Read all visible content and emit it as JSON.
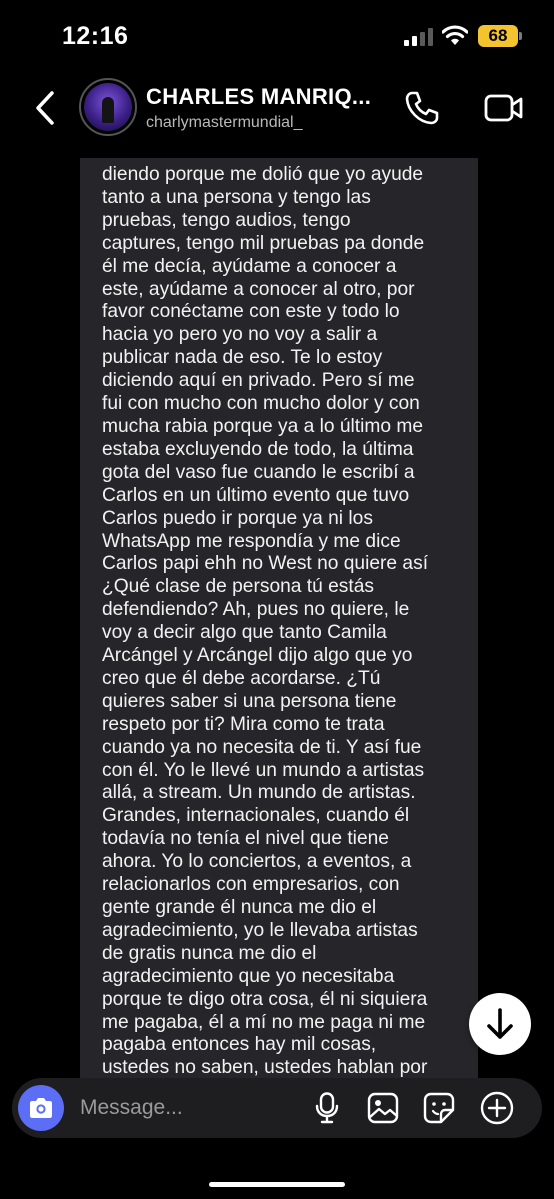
{
  "status_bar": {
    "time": "12:16",
    "battery": "68"
  },
  "header": {
    "name": "CHARLES MANRIQ...",
    "username": "charlymastermundial_"
  },
  "message": {
    "text": "diendo porque me dolió que yo ayude\ntanto a una persona y tengo las\npruebas, tengo audios, tengo\ncaptures, tengo mil pruebas pa donde\nél me decía, ayúdame a conocer a\neste, ayúdame a conocer al otro, por\nfavor conéctame con este y todo lo\nhacia yo pero yo no voy a salir a\npublicar nada de eso. Te lo estoy\ndiciendo aquí en privado. Pero sí me\nfui con mucho con mucho dolor y con\nmucha rabia porque ya a lo último me\nestaba excluyendo de todo, la última\ngota del vaso fue cuando le escribí a\nCarlos en un último evento que tuvo\nCarlos puedo ir porque ya ni los\nWhatsApp me respondía y me dice\nCarlos papi ehh no West no quiere así\n¿Qué clase de persona tú estás\ndefendiendo? Ah, pues no quiere, le\nvoy a decir algo que tanto Camila\nArcángel y Arcángel dijo algo que yo\ncreo que él debe acordarse. ¿Tú\nquieres saber si una persona tiene\nrespeto por ti? Mira como te trata\ncuando ya no necesita de ti. Y así fue\ncon él. Yo le llevé un mundo a artistas\nallá, a stream. Un mundo de artistas.\nGrandes, internacionales, cuando él\ntodavía no tenía el nivel que tiene\nahora. Yo lo conciertos, a eventos, a\nrelacionarlos con empresarios, con\ngente grande él nunca me dio el\nagradecimiento, yo le llevaba artistas\nde gratis nunca me dio el\nagradecimiento que yo necesitaba\nporque te digo otra cosa, él ni siquiera\nme pagaba, él a mí no me paga ni me\npagaba entonces hay mil cosas,\nustedes no saben, ustedes hablan por\nhablar y no es así fíjate esa locura que"
  },
  "composer": {
    "placeholder": "Message..."
  },
  "icons": {
    "back": "chevron-left-icon",
    "phone": "phone-icon",
    "video": "video-camera-icon",
    "scroll_down": "arrow-down-icon",
    "camera": "camera-icon",
    "mic": "microphone-icon",
    "gallery": "image-icon",
    "sticker": "sticker-icon",
    "add": "plus-circle-icon"
  },
  "colors": {
    "background": "#000000",
    "bubble": "#26262a",
    "camera_button": "#5b6ef5",
    "battery": "#f4c430"
  }
}
